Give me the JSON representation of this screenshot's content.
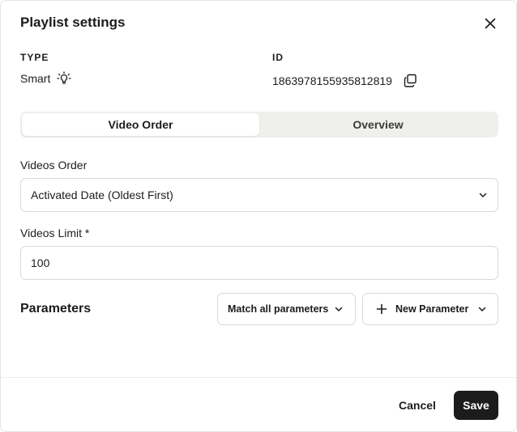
{
  "dialog": {
    "title": "Playlist settings",
    "close_icon": "close-icon"
  },
  "meta": {
    "type_label": "TYPE",
    "type_value": "Smart",
    "type_icon": "lightbulb-icon",
    "id_label": "ID",
    "id_value": "1863978155935812819",
    "copy_icon": "copy-icon"
  },
  "tabs": [
    {
      "label": "Video Order",
      "active": true
    },
    {
      "label": "Overview",
      "active": false
    }
  ],
  "videos_order": {
    "label": "Videos Order",
    "selected": "Activated Date (Oldest First)",
    "icon": "chevron-down-icon"
  },
  "videos_limit": {
    "label": "Videos Limit *",
    "value": "100"
  },
  "parameters": {
    "title": "Parameters",
    "match_button": "Match all parameters",
    "new_button": "New Parameter",
    "plus_icon": "plus-icon",
    "chevron_icon": "chevron-down-icon"
  },
  "footer": {
    "cancel": "Cancel",
    "save": "Save"
  },
  "colors": {
    "primary_button": "#1c1c1c",
    "tab_track": "#efefec",
    "border": "#d8d8d6"
  }
}
